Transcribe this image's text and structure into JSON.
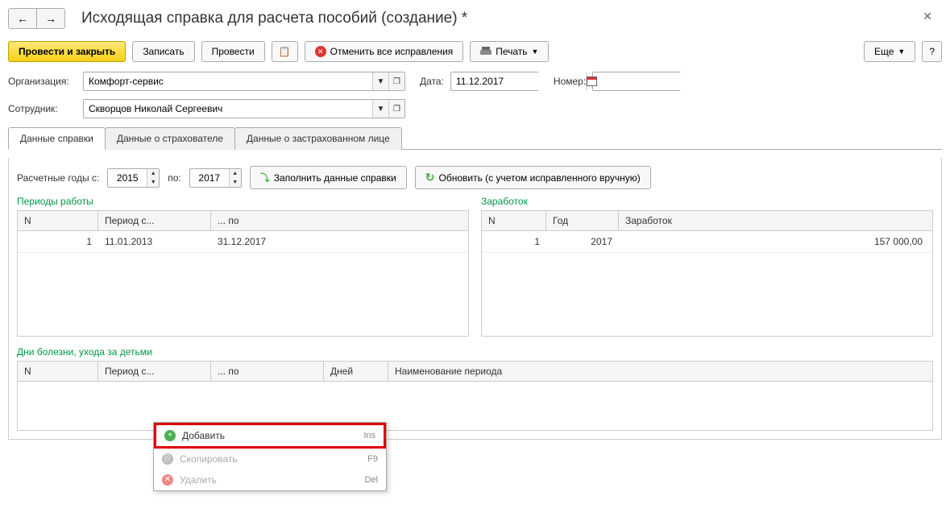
{
  "title": "Исходящая справка для расчета пособий (создание) *",
  "toolbar": {
    "submit_close": "Провести и закрыть",
    "save": "Записать",
    "submit": "Провести",
    "cancel_corrections": "Отменить все исправления",
    "print": "Печать",
    "more": "Еще",
    "help": "?"
  },
  "form": {
    "org_label": "Организация:",
    "org_value": "Комфорт-сервис",
    "date_label": "Дата:",
    "date_value": "11.12.2017",
    "number_label": "Номер:",
    "number_value": "",
    "employee_label": "Сотрудник:",
    "employee_value": "Скворцов Николай Сергеевич"
  },
  "tabs": {
    "t1": "Данные справки",
    "t2": "Данные о страхователе",
    "t3": "Данные о застрахованном лице"
  },
  "calc": {
    "years_from_label": "Расчетные годы с:",
    "years_from": "2015",
    "years_to_label": "по:",
    "years_to": "2017",
    "fill_button": "Заполнить данные справки",
    "refresh_button": "Обновить (с учетом исправленного вручную)"
  },
  "periods": {
    "title": "Периоды работы",
    "col_n": "N",
    "col_from": "Период с...",
    "col_to": "... по",
    "rows": [
      {
        "n": "1",
        "from": "11.01.2013",
        "to": "31.12.2017"
      }
    ]
  },
  "earnings": {
    "title": "Заработок",
    "col_n": "N",
    "col_year": "Год",
    "col_amount": "Заработок",
    "rows": [
      {
        "n": "1",
        "year": "2017",
        "amount": "157 000,00"
      }
    ]
  },
  "sickness": {
    "title": "Дни болезни, ухода за детьми",
    "col_n": "N",
    "col_from": "Период с...",
    "col_to": "... по",
    "col_days": "Дней",
    "col_name": "Наименование периода"
  },
  "ctx": {
    "add": "Добавить",
    "add_key": "Ins",
    "copy": "Скопировать",
    "copy_key": "F9",
    "delete": "Удалить",
    "delete_key": "Del"
  }
}
